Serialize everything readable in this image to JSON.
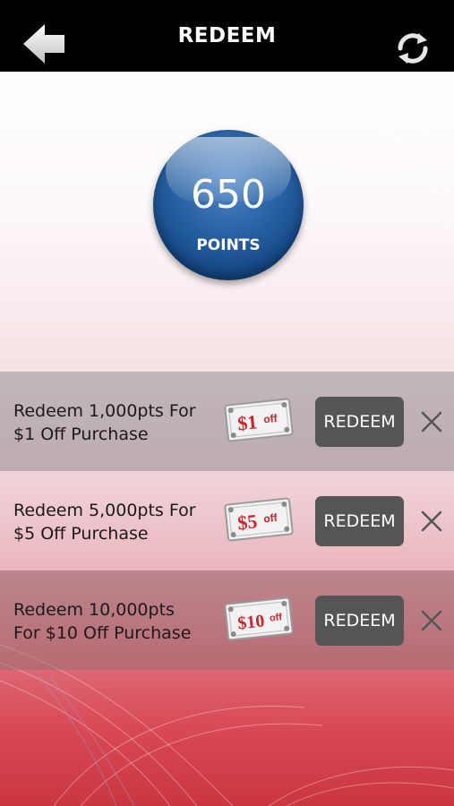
{
  "header": {
    "title": "REDEEM",
    "back_icon": "arrow-left-icon",
    "refresh_icon": "refresh-icon"
  },
  "points": {
    "value": "650",
    "label": "POINTS"
  },
  "offers": [
    {
      "text_line1": "Redeem 1,000pts For",
      "text_line2": "$1 Off Purchase",
      "coupon_amount": "$1",
      "coupon_suffix": "off",
      "button_label": "REDEEM",
      "dismiss_icon": "close-icon"
    },
    {
      "text_line1": "Redeem 5,000pts For",
      "text_line2": "$5 Off Purchase",
      "coupon_amount": "$5",
      "coupon_suffix": "off",
      "button_label": "REDEEM",
      "dismiss_icon": "close-icon"
    },
    {
      "text_line1": "Redeem 10,000pts",
      "text_line2": "For $10 Off Purchase",
      "coupon_amount": "$10",
      "coupon_suffix": "off",
      "button_label": "REDEEM",
      "dismiss_icon": "close-icon"
    }
  ],
  "colors": {
    "topbar": "#000000",
    "points_ball": "#1e5a9e",
    "button": "#555555",
    "coupon_text": "#d0232b",
    "background_bottom": "#c9363f"
  }
}
